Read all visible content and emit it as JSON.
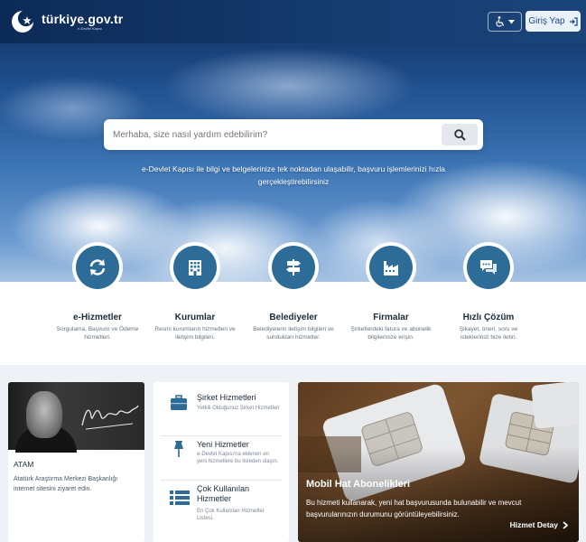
{
  "header": {
    "logo_text": "türkiye.gov.tr",
    "logo_sub": "e-Devlet Kapısı",
    "login_label": "Giriş Yap"
  },
  "search": {
    "placeholder": "Merhaba, size nasıl yardım edebilirim?"
  },
  "tagline": "e-Devlet Kapısı ile bilgi ve belgelerinize tek noktadan ulaşabilir, başvuru işlemlerinizi hızla gerçekleştirebilirsiniz",
  "services": [
    {
      "title": "e-Hizmetler",
      "desc": "Sorgulama, Başvuru ve Ödeme hizmetleri.",
      "icon": "refresh-icon"
    },
    {
      "title": "Kurumlar",
      "desc": "Resmi kurumların hizmetleri ve iletişim bilgileri.",
      "icon": "building-icon"
    },
    {
      "title": "Belediyeler",
      "desc": "Belediyelerin iletişim bilgileri ve sundukları hizmetler.",
      "icon": "signpost-icon"
    },
    {
      "title": "Firmalar",
      "desc": "Şirketlerdeki fatura ve abonelik bilgilerinize erişin.",
      "icon": "factory-icon"
    },
    {
      "title": "Hızlı Çözüm",
      "desc": "Şikayet, öneri, soru ve isteklerinizi bize iletin.",
      "icon": "chat-icon"
    }
  ],
  "atam": {
    "title": "ATAM",
    "desc": "Atatürk Araştırma Merkezi Başkanlığı internet sitesini ziyaret edin.",
    "signature": "K. Atatürk"
  },
  "list": [
    {
      "title": "Şirket Hizmetleri",
      "desc": "Yetkili Olduğunuz Şirket Hizmetleri",
      "icon": "briefcase-icon"
    },
    {
      "title": "Yeni Hizmetler",
      "desc": "e-Devlet Kapısı'na eklenen en yeni hizmetlere bu listeden ulaşın.",
      "icon": "pin-icon"
    },
    {
      "title": "Çok Kullanılan Hizmetler",
      "desc": "En Çok Kullanılan Hizmetler Listesi.",
      "icon": "list-icon"
    }
  ],
  "promo": {
    "title": "Mobil Hat Abonelikleri",
    "desc": "Bu hizmeti kullanarak, yeni hat başvurusunda bulunabilir ve mevcut başvurularınızın durumunu görüntüleyebilirsiniz.",
    "link": "Hizmet Detay"
  },
  "colors": {
    "accent": "#2e6c98",
    "header": "#163c70"
  }
}
